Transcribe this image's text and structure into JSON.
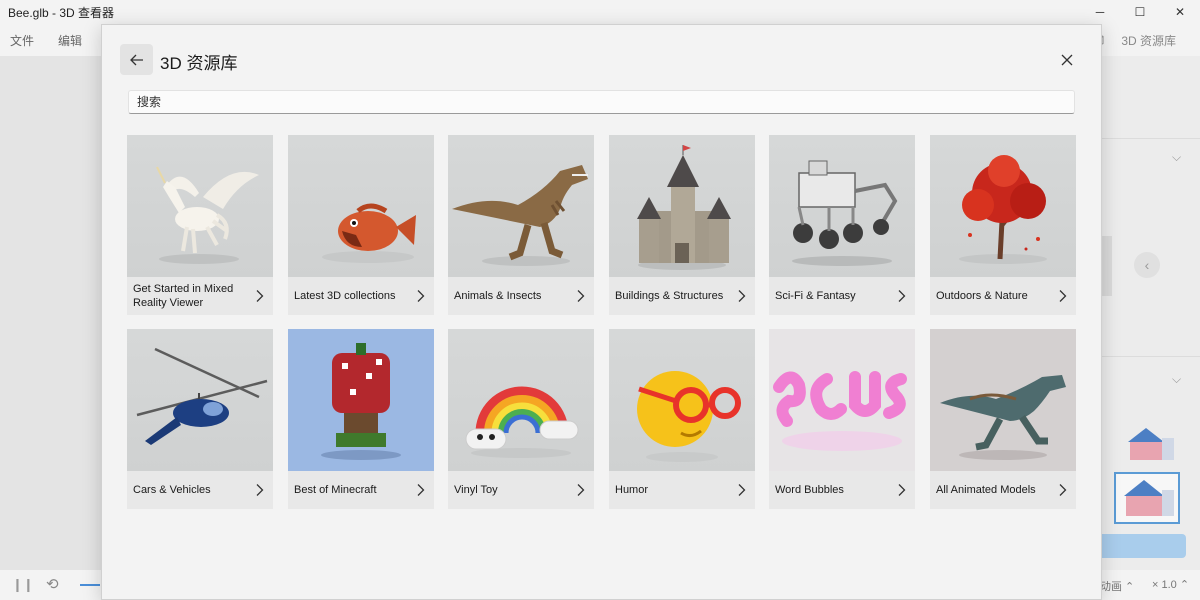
{
  "window": {
    "title": "Bee.glb - 3D 查看器",
    "menu": [
      "文件",
      "编辑"
    ],
    "library_button": "3D 资源库",
    "minimize_glyph": "─",
    "maximize_glyph": "☐",
    "close_glyph": "✕"
  },
  "bottombar": {
    "animation_label": "动画",
    "speed_label": "× 1.0"
  },
  "dialog": {
    "title": "3D 资源库",
    "search_placeholder": "搜索",
    "tiles": [
      {
        "label": "Get Started in Mixed Reality Viewer",
        "thumb": "pegasus"
      },
      {
        "label": "Latest 3D collections",
        "thumb": "fish"
      },
      {
        "label": "Animals & Insects",
        "thumb": "trex"
      },
      {
        "label": "Buildings & Structures",
        "thumb": "castle"
      },
      {
        "label": "Sci-Fi & Fantasy",
        "thumb": "rover"
      },
      {
        "label": "Outdoors & Nature",
        "thumb": "red-tree"
      },
      {
        "label": "Cars & Vehicles",
        "thumb": "helicopter"
      },
      {
        "label": "Best of Minecraft",
        "thumb": "minecraft-tree"
      },
      {
        "label": "Vinyl Toy",
        "thumb": "rainbow"
      },
      {
        "label": "Humor",
        "thumb": "emoji"
      },
      {
        "label": "Word Bubbles",
        "thumb": "bubble-text"
      },
      {
        "label": "All Animated Models",
        "thumb": "animated-dino"
      }
    ]
  },
  "colors": {
    "accent": "#4a8ed8",
    "dialog_bg": "#f3f3f3",
    "tile_caption_bg": "#e8e8e8"
  }
}
